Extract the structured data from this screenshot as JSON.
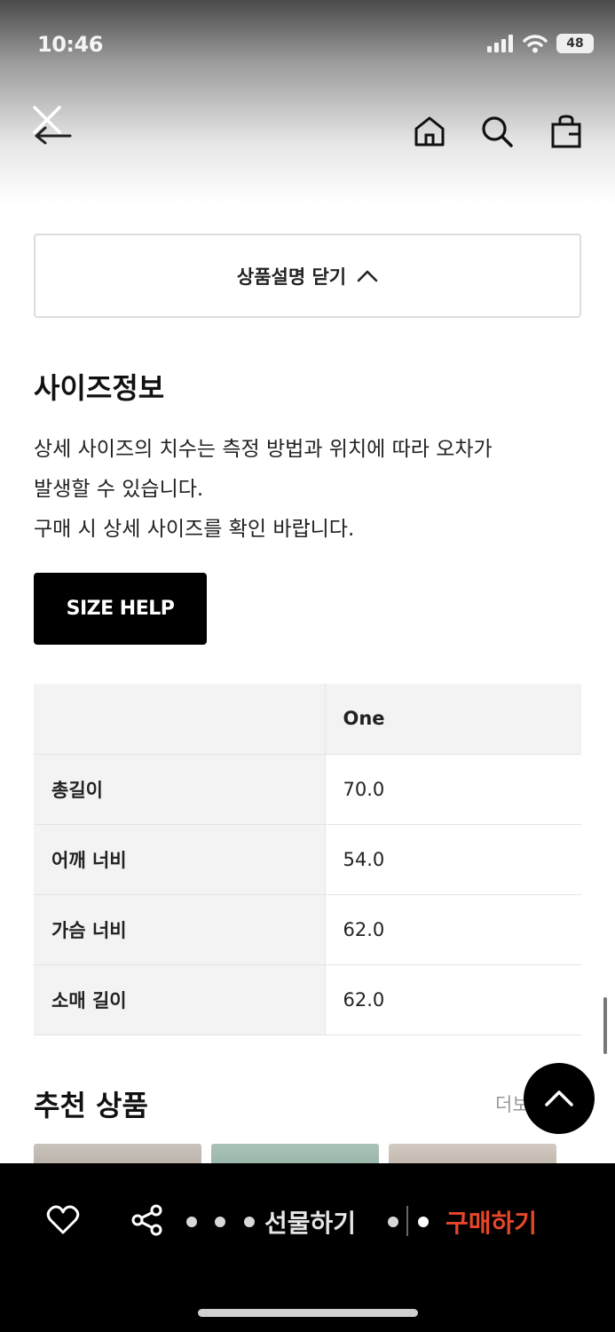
{
  "status_bar": {
    "time": "10:46",
    "battery": "48"
  },
  "nav": {
    "close_label": "close",
    "icons": [
      "home-icon",
      "search-icon",
      "bag-icon"
    ]
  },
  "product": {
    "collapse_label": "상품설명 닫기"
  },
  "size_info": {
    "title": "사이즈정보",
    "description": [
      "상세 사이즈의 치수는 측정 방법과 위치에 따라 오차가",
      "발생할 수 있습니다.",
      "구매 시 상세 사이즈를 확인 바랍니다."
    ],
    "help_button": "SIZE HELP",
    "table": {
      "header": [
        "",
        "One"
      ],
      "rows": [
        {
          "label": "총길이",
          "value": "70.0"
        },
        {
          "label": "어깨 너비",
          "value": "54.0"
        },
        {
          "label": "가슴 너비",
          "value": "62.0"
        },
        {
          "label": "소매 길이",
          "value": "62.0"
        }
      ]
    }
  },
  "recommend": {
    "title": "추천 상품",
    "more": "더보"
  },
  "bottom_bar": {
    "gift_label": "선물하기",
    "buy_label": "구매하기"
  },
  "colors": {
    "accent": "#e8462a",
    "background": "#ffffff",
    "bar": "#000000"
  }
}
